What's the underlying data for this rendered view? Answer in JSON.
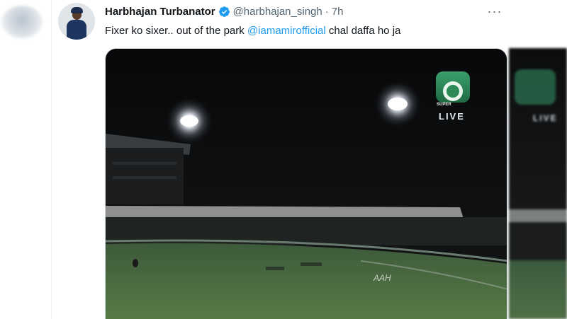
{
  "tweet": {
    "author_name": "Harbhajan Turbanator",
    "handle": "@harbhajan_singh",
    "separator": "·",
    "time": "7h",
    "text_before": "Fixer ko sixer.. out of the park ",
    "mention": "@iamamirofficial",
    "text_after": " chal daffa ho ja",
    "more_icon": "···"
  },
  "video": {
    "channel_logo_text": "SUPER",
    "live_badge": "LIVE",
    "ghost_live_badge": "LIVE",
    "board_text": "AAH"
  },
  "colors": {
    "link": "#1d9bf0",
    "text": "#0f1419",
    "secondary": "#536471",
    "verified": "#1d9bf0",
    "logo_green": "#2e8b57"
  },
  "icons": [
    "verified-badge-icon",
    "more-options-icon",
    "channel-logo-icon"
  ]
}
